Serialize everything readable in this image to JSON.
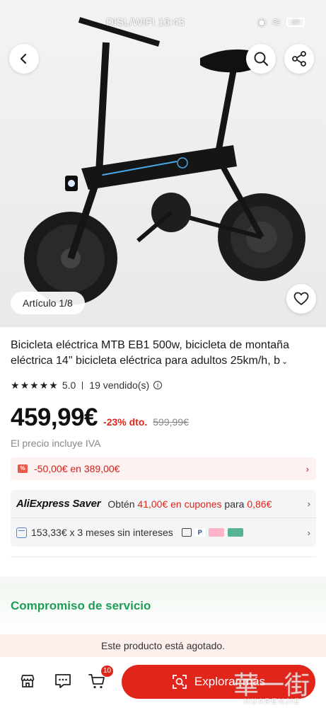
{
  "status_bar": {
    "text": "DISL/WIFI 16:43",
    "battery": "60"
  },
  "hero": {
    "counter": "Artículo 1/8"
  },
  "product": {
    "title": "Bicicleta eléctrica MTB EB1 500w, bicicleta de montaña eléctrica 14\" bicicleta eléctrica para adultos 25km/h, b",
    "rating": "5.0",
    "stars": 5,
    "sold": "19 vendido(s)",
    "price": "459,99€",
    "discount": "-23% dto.",
    "old_price": "599,99€",
    "vat_note": "El precio incluye IVA"
  },
  "coupon": {
    "text": "-50,00€ en 389,00€"
  },
  "saver": {
    "brand": "AliExpress Saver",
    "prefix": "Obtén",
    "amount": "41,00€ en cupones",
    "middle": "para",
    "price": "0,86€"
  },
  "installments": {
    "text": "153,33€ x 3 meses sin intereses"
  },
  "service": {
    "title": "Compromiso de servicio"
  },
  "notice": {
    "sold_out": "Este producto está agotado."
  },
  "bottom_bar": {
    "cart_count": "10",
    "explore_label": "Explorar más"
  },
  "watermark": {
    "text": "HUARENJIE"
  },
  "colors": {
    "accent_red": "#e1251b",
    "service_green": "#1f9d55",
    "coupon_bg": "#fdf2f2",
    "soldout_bg": "#fcefec"
  }
}
